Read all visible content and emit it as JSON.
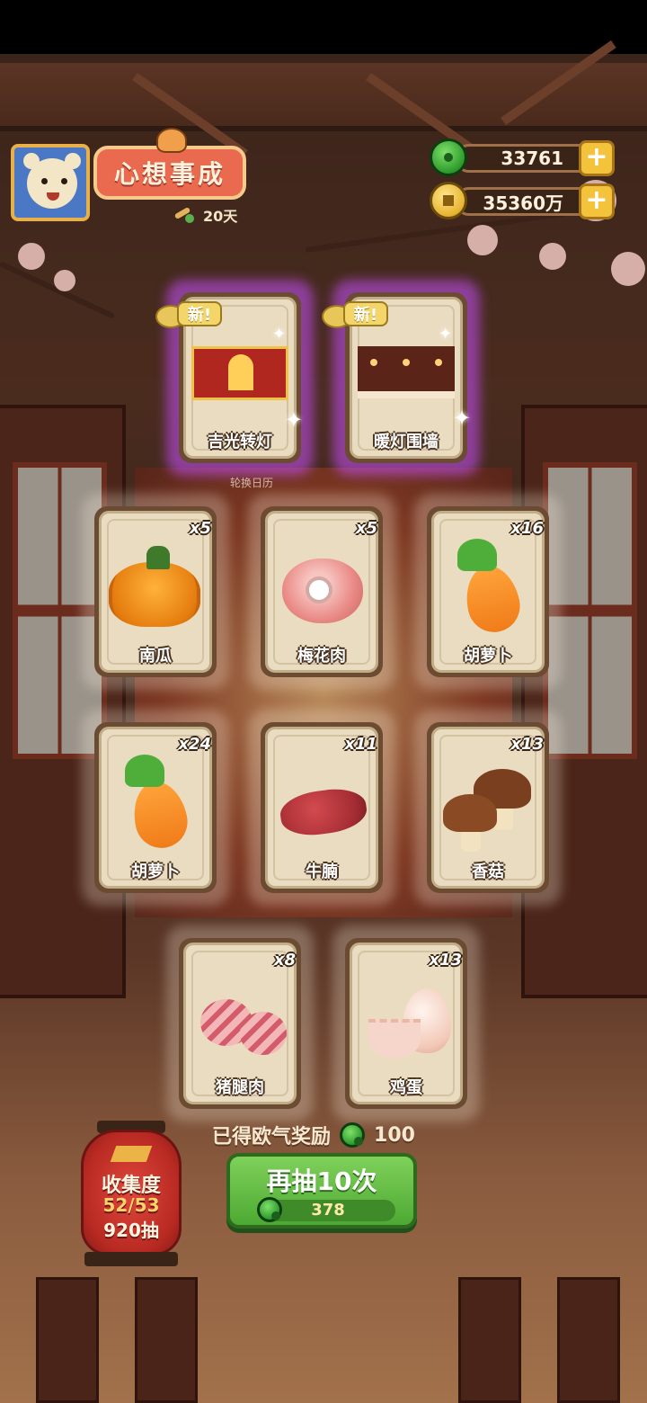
{
  "player": {
    "title": "心想事成",
    "days": "20天"
  },
  "currencies": {
    "jade": "33761",
    "gold": "35360万"
  },
  "new_tag": "新!",
  "new_cards": [
    {
      "name": "吉光转灯"
    },
    {
      "name": "暖灯围墙"
    }
  ],
  "rotate_label": "轮换日历",
  "cards": [
    {
      "name": "南瓜",
      "qty": "x5",
      "art": "pumpkin"
    },
    {
      "name": "梅花肉",
      "qty": "x5",
      "art": "meat"
    },
    {
      "name": "胡萝卜",
      "qty": "x16",
      "art": "carrot"
    },
    {
      "name": "胡萝卜",
      "qty": "x24",
      "art": "carrot"
    },
    {
      "name": "牛腩",
      "qty": "x11",
      "art": "beef"
    },
    {
      "name": "香菇",
      "qty": "x13",
      "art": "mushroom"
    },
    {
      "name": "猪腿肉",
      "qty": "x8",
      "art": "ham"
    },
    {
      "name": "鸡蛋",
      "qty": "x13",
      "art": "egg"
    }
  ],
  "reward": {
    "label": "已得欧气奖励",
    "value": "100"
  },
  "draw_button": {
    "label": "再抽10次",
    "cost": "378"
  },
  "collection": {
    "label": "收集度",
    "progress": "52/53",
    "draws": "920抽"
  },
  "colors": {
    "draw_button": "#5cb83b",
    "lantern": "#c93328",
    "new_glow": "#c850ff"
  }
}
